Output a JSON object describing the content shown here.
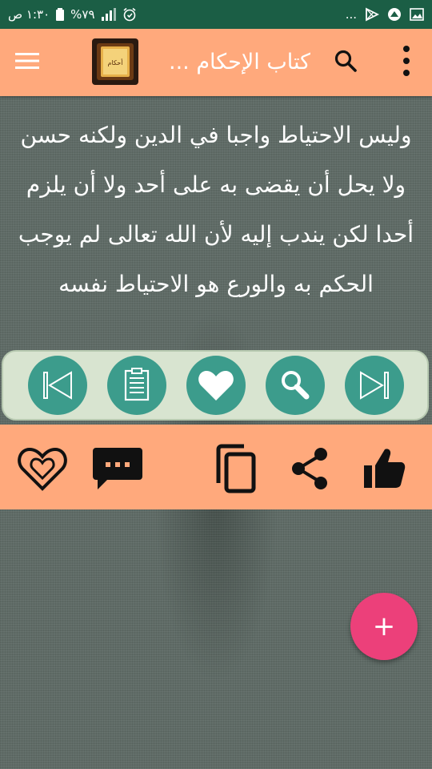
{
  "status_bar": {
    "time": "١:٣٠ ص",
    "battery_percent": "%٧٩",
    "more_indicator": "..."
  },
  "app_bar": {
    "title": "كتاب الإحكام ...",
    "logo_text": "أحكام",
    "icons": {
      "menu": "menu-icon",
      "search": "search-icon",
      "overflow": "more-vert-icon"
    }
  },
  "content": {
    "text": "وليس الاحتياط واجبا في الدين ولكنه حسن ولا يحل أن يقضى به على أحد ولا أن يلزم أحدا لكن يندب إليه لأن الله تعالى لم يوجب الحكم به والورع هو الاحتياط نفسه"
  },
  "nav_buttons": [
    "first-page-icon",
    "index-icon",
    "favorite-icon",
    "search-icon",
    "last-page-icon"
  ],
  "action_bar": [
    "favorite-outline-icon",
    "comment-icon",
    "copy-icon",
    "share-icon",
    "thumb-up-icon"
  ],
  "fab": {
    "label": "+"
  },
  "colors": {
    "status_bar": "#1b5e45",
    "app_bar": "#ffa97c",
    "nav_button": "#3c9c8c",
    "nav_panel": "#d8e4d0",
    "fab": "#ec407a"
  }
}
